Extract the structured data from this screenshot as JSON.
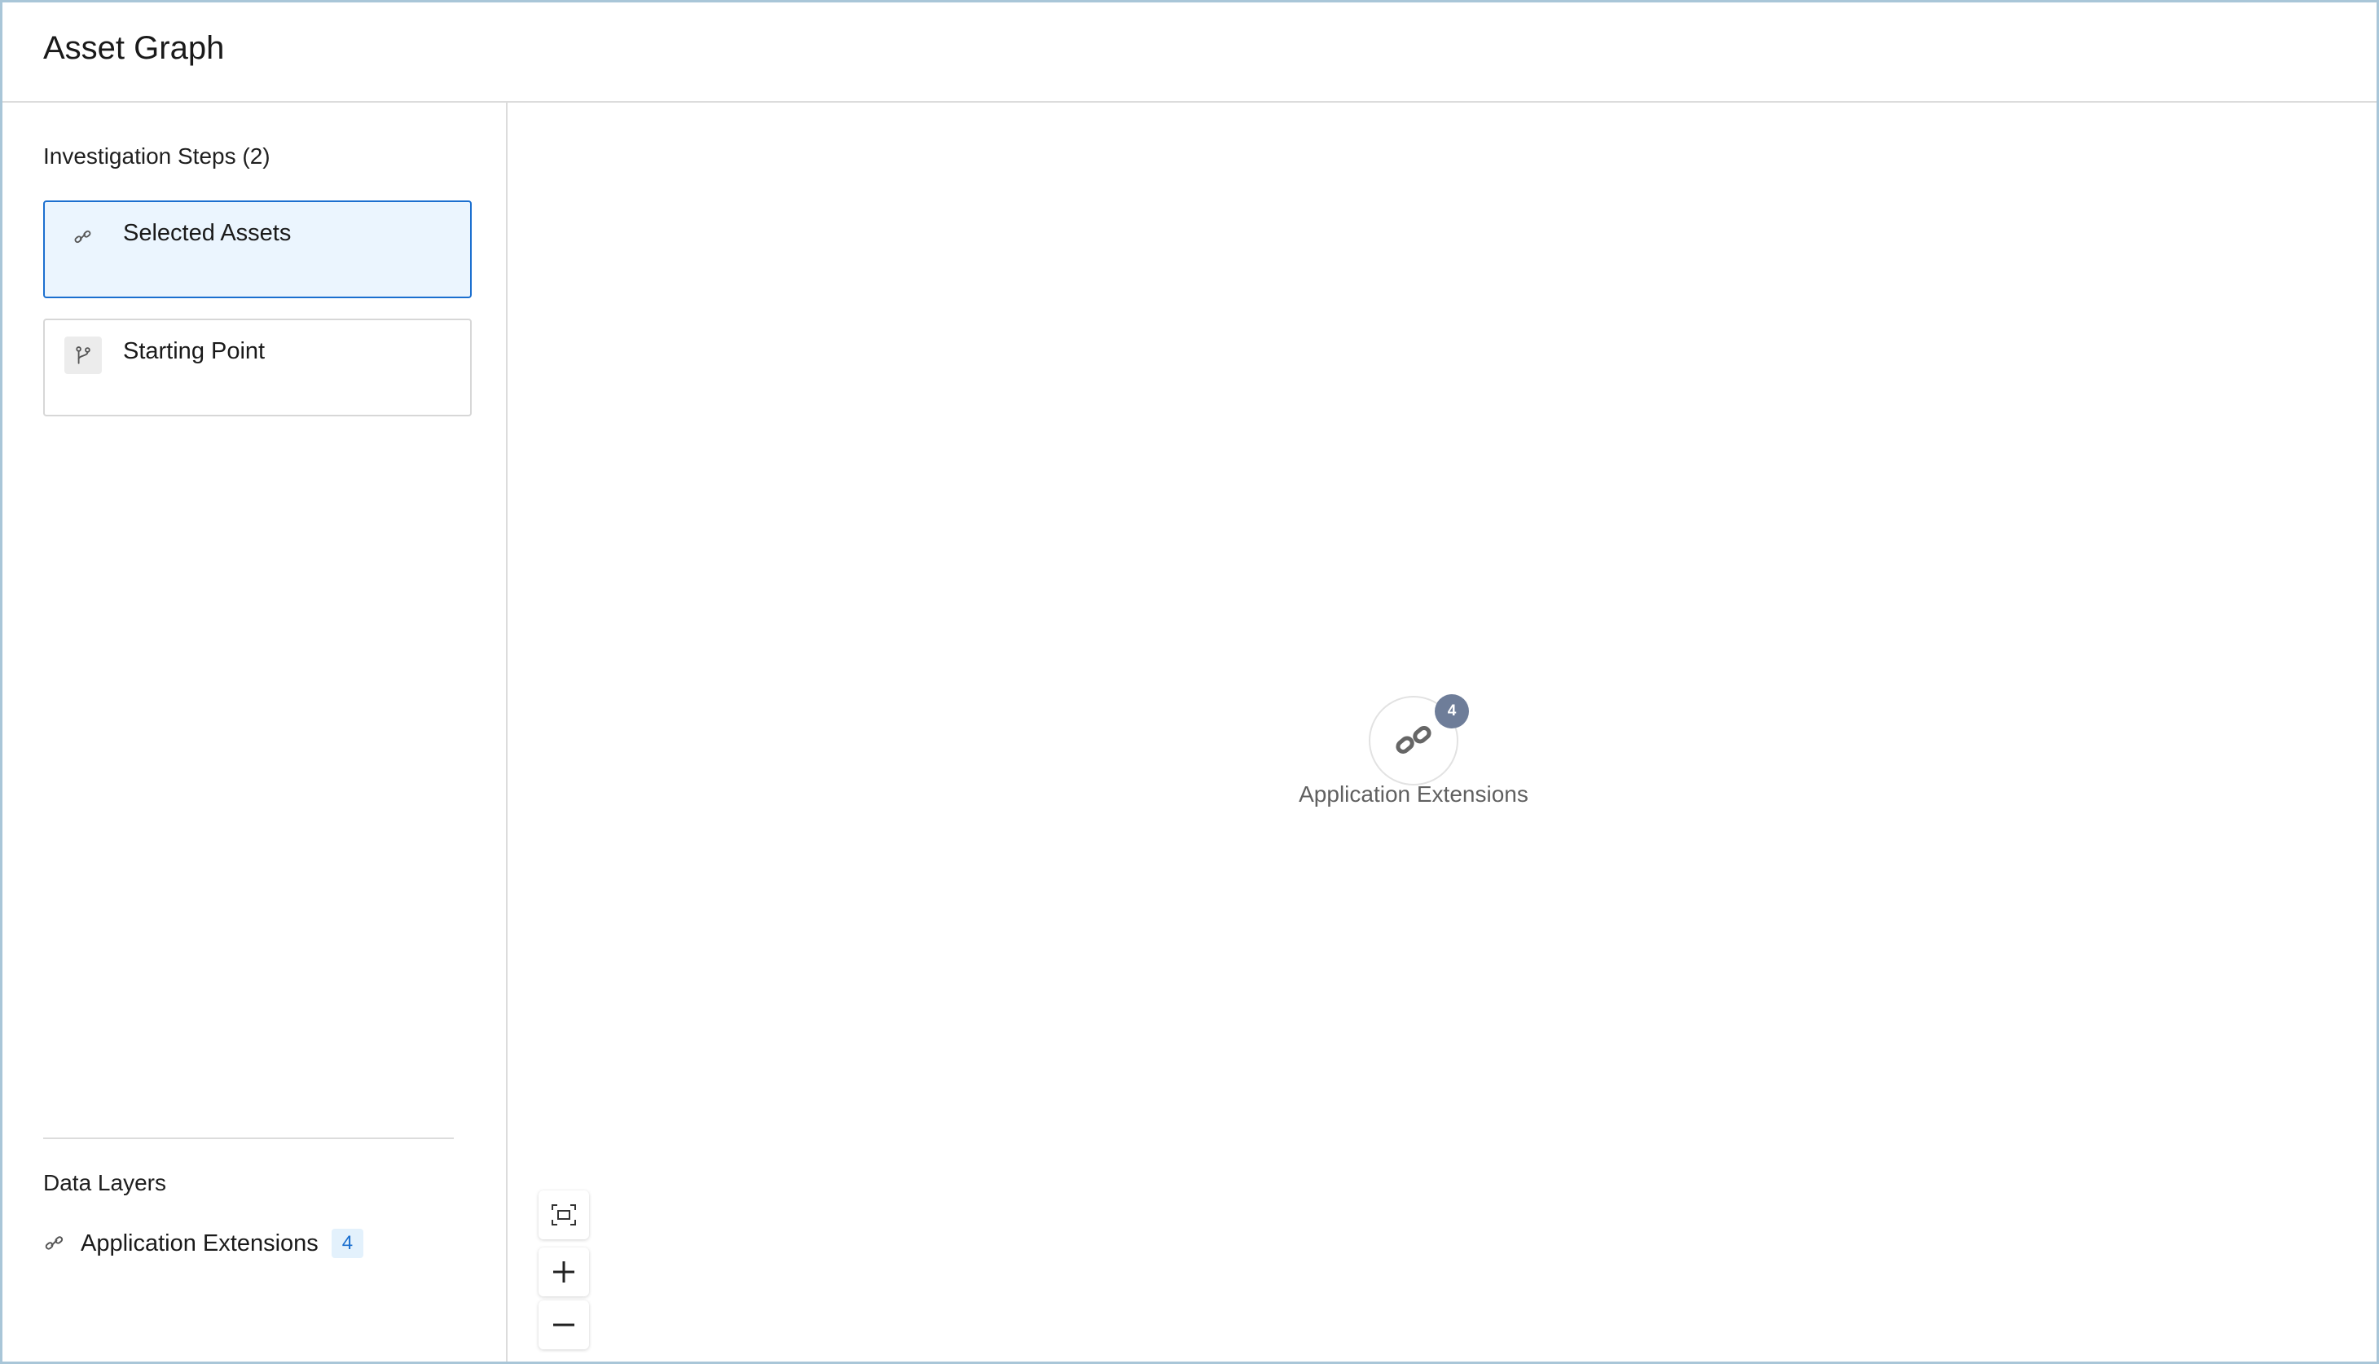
{
  "header": {
    "title": "Asset Graph"
  },
  "sidebar": {
    "steps_title": "Investigation Steps (2)",
    "steps": [
      {
        "label": "Selected Assets",
        "icon": "link-icon",
        "selected": true
      },
      {
        "label": "Starting Point",
        "icon": "branch-icon",
        "selected": false
      }
    ],
    "layers_title": "Data Layers",
    "layers": [
      {
        "label": "Application Extensions",
        "count": "4",
        "icon": "link-icon"
      }
    ]
  },
  "graph": {
    "nodes": [
      {
        "label": "Application Extensions",
        "count": "4",
        "icon": "link-icon"
      }
    ]
  },
  "controls": {
    "fit": "fit-view-icon",
    "zoom_in": "plus-icon",
    "zoom_out": "minus-icon"
  },
  "colors": {
    "accent": "#1b6fcf",
    "selected_bg": "#ebf5fe",
    "badge": "#6e7d99",
    "frame": "#a9c6d8"
  }
}
